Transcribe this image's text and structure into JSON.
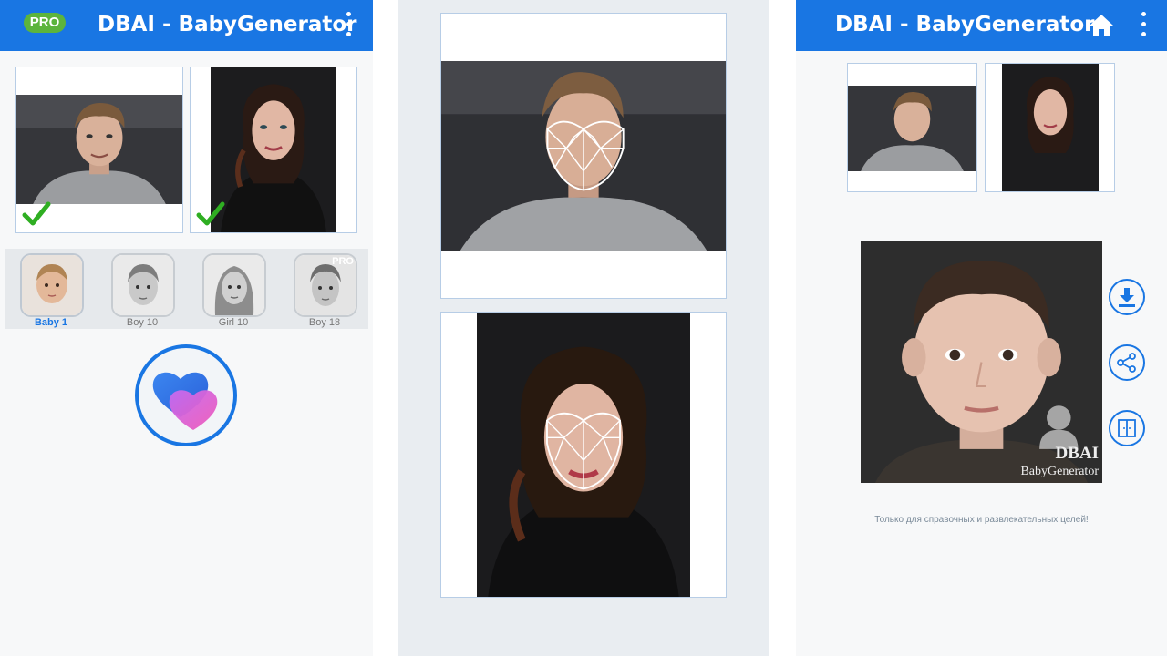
{
  "screen1": {
    "pro_badge": "PRO",
    "app_title": "DBAI - BabyGenerator",
    "presets": [
      {
        "label": "Baby 1",
        "selected": true,
        "pro": false
      },
      {
        "label": "Boy 10",
        "selected": false,
        "pro": false
      },
      {
        "label": "Girl 10",
        "selected": false,
        "pro": false
      },
      {
        "label": "Boy 18",
        "selected": false,
        "pro": true
      }
    ],
    "pro_tag": "PRO"
  },
  "screen3": {
    "app_title": "DBAI - BabyGenerator",
    "watermark_line1": "DBAI",
    "watermark_line2": "BabyGenerator",
    "disclaimer": "Только для справочных и развлекательных целей!"
  },
  "icons": {
    "menu": "kebab-menu-icon",
    "home": "home-icon",
    "check": "checkmark-icon",
    "generate": "hearts-icon",
    "download": "download-icon",
    "share": "share-icon",
    "compare": "compare-icon"
  },
  "colors": {
    "accent": "#1976e3",
    "pro_badge": "#5cb43c",
    "check": "#2fae22",
    "heart_blue": "#2e6fe8",
    "heart_pink": "#e057c9"
  }
}
